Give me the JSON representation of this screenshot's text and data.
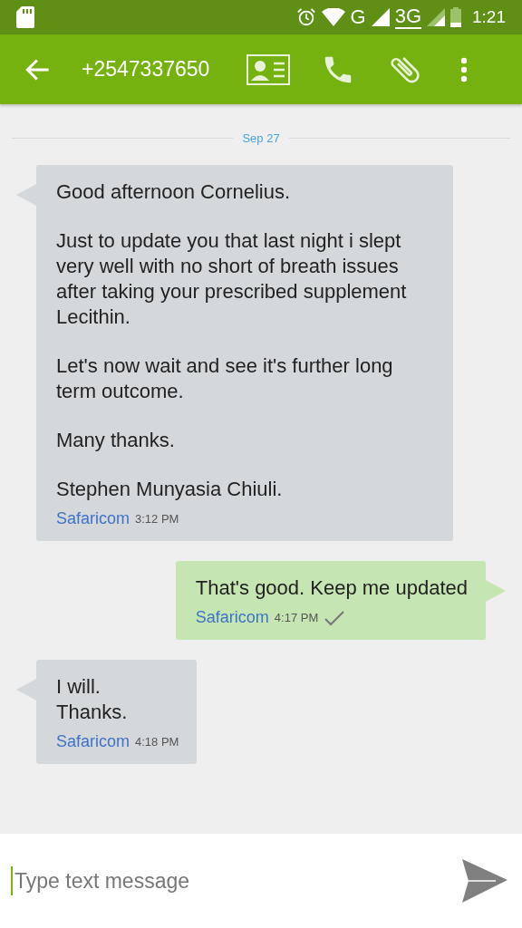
{
  "status_bar": {
    "network": "G",
    "network_2": "3G",
    "time": "1:21"
  },
  "app_bar": {
    "title": "+2547337650"
  },
  "date_divider": "Sep 27",
  "messages": [
    {
      "kind": "incoming",
      "paragraphs": [
        "Good afternoon Cornelius.",
        "Just to update you that last night i slept very well with no short of breath issues after taking your prescribed supplement Lecithin.",
        "Let's now wait and see it's further long term outcome.",
        "Many thanks.",
        "Stephen Munyasia Chiuli."
      ],
      "carrier": "Safaricom",
      "time": "3:12 PM",
      "delivered": false
    },
    {
      "kind": "outgoing",
      "paragraphs": [
        "That's good. Keep me updated"
      ],
      "carrier": "Safaricom",
      "time": "4:17 PM",
      "delivered": true
    },
    {
      "kind": "incoming",
      "paragraphs": [
        "I will.\nThanks."
      ],
      "carrier": "Safaricom",
      "time": "4:18 PM",
      "delivered": false
    }
  ],
  "composer": {
    "placeholder": "Type text message"
  }
}
